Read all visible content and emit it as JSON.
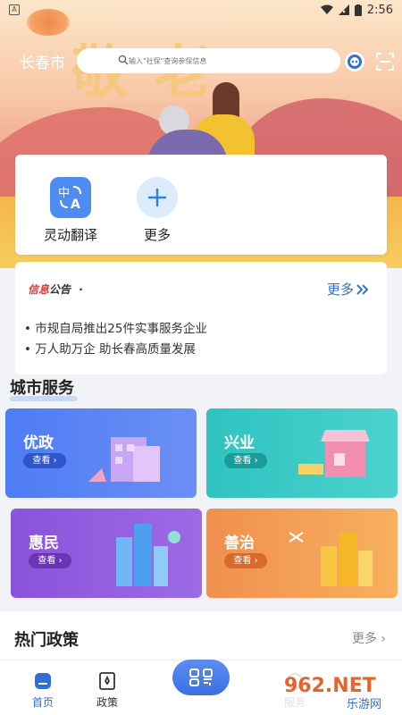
{
  "status_bar": {
    "time": "2:56",
    "notification_badge": "A"
  },
  "header": {
    "city": "长春市",
    "search_placeholder": "输入\"社保\"查询参保信息",
    "banner_text": "敬老"
  },
  "quick_actions": [
    {
      "label": "灵动翻译",
      "icon": "translate-icon"
    },
    {
      "label": "更多",
      "icon": "plus-icon"
    }
  ],
  "notice": {
    "logo_red": "信息",
    "logo_dark": "公告",
    "logo_dot": "·",
    "more_label": "更多",
    "items": [
      "市规自局推出25件实事服务企业",
      "万人助万企 助长春高质量发展"
    ]
  },
  "city_service": {
    "title": "城市服务",
    "cards": [
      {
        "name": "优政",
        "button": "查看"
      },
      {
        "name": "兴业",
        "button": "查看"
      },
      {
        "name": "惠民",
        "button": "查看"
      },
      {
        "name": "善治",
        "button": "查看"
      }
    ]
  },
  "hot_policy": {
    "title": "热门政策",
    "more": "更多 ›"
  },
  "tabbar": [
    {
      "label": "首页",
      "icon": "home-icon"
    },
    {
      "label": "政策",
      "icon": "policy-book-icon"
    },
    {
      "label": "服务",
      "icon": "service-icon"
    }
  ],
  "watermark": {
    "text": "962.NET",
    "sub": "乐游网"
  },
  "colors": {
    "primary": "#2f6fd6",
    "notice_red": "#e03a3a"
  }
}
